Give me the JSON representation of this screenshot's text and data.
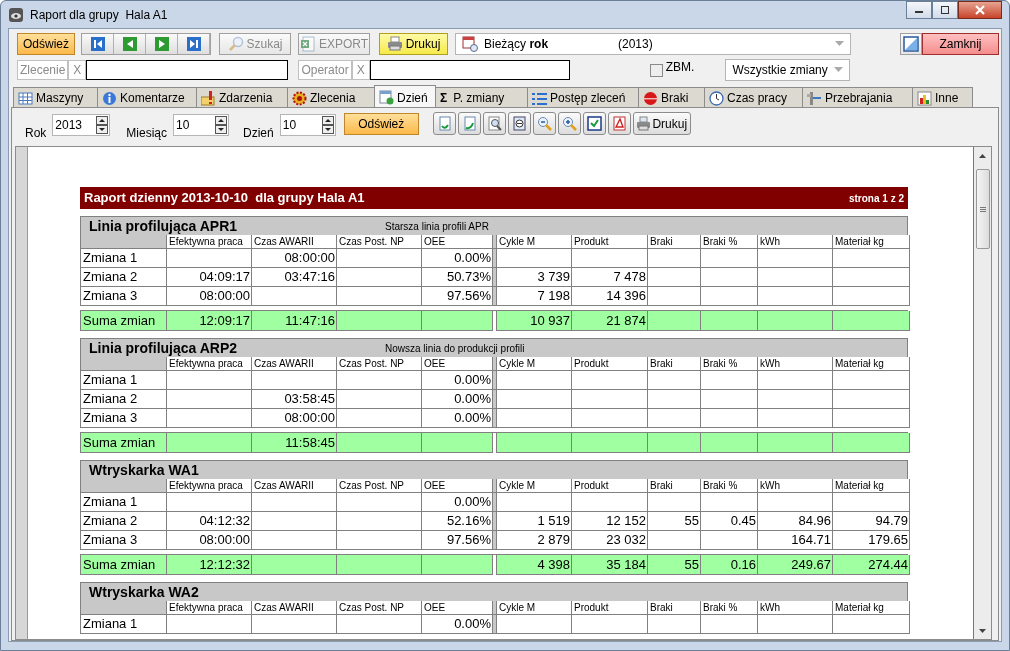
{
  "window": {
    "title": "Raport dla grupy  Hala A1"
  },
  "toolbar": {
    "refresh": "Odśwież",
    "buttons": [
      {
        "label": "Szukaj",
        "disabled": true
      },
      {
        "label": "EXPORT",
        "disabled": true
      },
      {
        "label": "Drukuj",
        "disabled": false
      }
    ],
    "period": {
      "label": "Bieżący **rok**",
      "year": "(2013)"
    },
    "close": "Zamknij",
    "filters": [
      {
        "label": "Zlecenie",
        "clear": "X"
      },
      {
        "label": "Operator",
        "clear": "X"
      }
    ],
    "zbm": {
      "label": "ZBM.",
      "checked": false
    },
    "shift_select": {
      "value": "Wszystkie zmiany"
    }
  },
  "tabs": [
    {
      "label": "Maszyny",
      "selected": false
    },
    {
      "label": "Komentarze",
      "selected": false
    },
    {
      "label": "Zdarzenia",
      "selected": false
    },
    {
      "label": "Zlecenia",
      "selected": false
    },
    {
      "label": "Dzień",
      "selected": true
    },
    {
      "label": "P. zmiany",
      "symbol": "Σ",
      "selected": false
    },
    {
      "label": "Postęp zleceń",
      "selected": false
    },
    {
      "label": "Braki",
      "selected": false
    },
    {
      "label": "Czas pracy",
      "selected": false
    },
    {
      "label": "Przebrajania",
      "selected": false
    },
    {
      "label": "Inne",
      "selected": false
    }
  ],
  "report_toolbar": {
    "fields": [
      {
        "label": "Rok",
        "value": "2013"
      },
      {
        "label": "Miesiąc",
        "value": "10"
      },
      {
        "label": "Dzień",
        "value": "10"
      }
    ],
    "refresh": "Odśwież",
    "print": "Drukuj"
  },
  "report": {
    "title": "Raport dzienny 2013-10-10  dla grupy Hala A1",
    "page": "strona 1 z 2",
    "sections": [
      {
        "name": "Linia profilująca APR1",
        "description": "Starsza linia profili APR",
        "columns": [
          "Efektywna praca",
          "Czas AWARII",
          "Czas Post. NP",
          "OEE",
          "Cykle M",
          "Produkt",
          "Braki",
          "Braki %",
          "kWh",
          "Materiał kg"
        ],
        "rows": [
          {
            "label": "Zmiana 1",
            "cells": [
              null,
              "08:00:00",
              null,
              "0.00%",
              null,
              null,
              null,
              null,
              null,
              null
            ]
          },
          {
            "label": "Zmiana 2",
            "cells": [
              "04:09:17",
              "03:47:16",
              null,
              "50.73%",
              "3 739",
              "7 478",
              null,
              null,
              null,
              null
            ]
          },
          {
            "label": "Zmiana 3",
            "cells": [
              "08:00:00",
              null,
              null,
              "97.56%",
              "7 198",
              "14 396",
              null,
              null,
              null,
              null
            ]
          }
        ],
        "total": {
          "label": "Suma zmian",
          "cells": [
            "12:09:17",
            "11:47:16",
            null,
            null,
            "10 937",
            "21 874",
            null,
            null,
            null,
            null
          ]
        }
      },
      {
        "name": "Linia profilująca ARP2",
        "description": "Nowsza linia do produkcji profili",
        "columns": [
          "Efektywna praca",
          "Czas AWARII",
          "Czas Post. NP",
          "OEE",
          "Cykle M",
          "Produkt",
          "Braki",
          "Braki %",
          "kWh",
          "Materiał kg"
        ],
        "rows": [
          {
            "label": "Zmiana 1",
            "cells": [
              null,
              null,
              null,
              "0.00%",
              null,
              null,
              null,
              null,
              null,
              null
            ]
          },
          {
            "label": "Zmiana 2",
            "cells": [
              null,
              "03:58:45",
              null,
              "0.00%",
              null,
              null,
              null,
              null,
              null,
              null
            ]
          },
          {
            "label": "Zmiana 3",
            "cells": [
              null,
              "08:00:00",
              null,
              "0.00%",
              null,
              null,
              null,
              null,
              null,
              null
            ]
          }
        ],
        "total": {
          "label": "Suma zmian",
          "cells": [
            null,
            "11:58:45",
            null,
            null,
            null,
            null,
            null,
            null,
            null,
            null
          ]
        }
      },
      {
        "name": "Wtryskarka WA1",
        "columns": [
          "Efektywna praca",
          "Czas AWARII",
          "Czas Post. NP",
          "OEE",
          "Cykle M",
          "Produkt",
          "Braki",
          "Braki %",
          "kWh",
          "Materiał kg"
        ],
        "rows": [
          {
            "label": "Zmiana 1",
            "cells": [
              null,
              null,
              null,
              "0.00%",
              null,
              null,
              null,
              null,
              null,
              null
            ]
          },
          {
            "label": "Zmiana 2",
            "cells": [
              "04:12:32",
              null,
              null,
              "52.16%",
              "1 519",
              "12 152",
              "55",
              "0.45",
              "84.96",
              "94.79"
            ]
          },
          {
            "label": "Zmiana 3",
            "cells": [
              "08:00:00",
              null,
              null,
              "97.56%",
              "2 879",
              "23 032",
              null,
              null,
              "164.71",
              "179.65"
            ]
          }
        ],
        "total": {
          "label": "Suma zmian",
          "cells": [
            "12:12:32",
            null,
            null,
            null,
            "4 398",
            "35 184",
            "55",
            "0.16",
            "249.67",
            "274.44"
          ]
        }
      },
      {
        "name": "Wtryskarka WA2",
        "columns": [
          "Efektywna praca",
          "Czas AWARII",
          "Czas Post. NP",
          "OEE",
          "Cykle M",
          "Produkt",
          "Braki",
          "Braki %",
          "kWh",
          "Materiał kg"
        ],
        "rows": [
          {
            "label": "Zmiana 1",
            "cells": [
              null,
              null,
              null,
              "0.00%",
              null,
              null,
              null,
              null,
              null,
              null
            ]
          }
        ]
      }
    ]
  }
}
